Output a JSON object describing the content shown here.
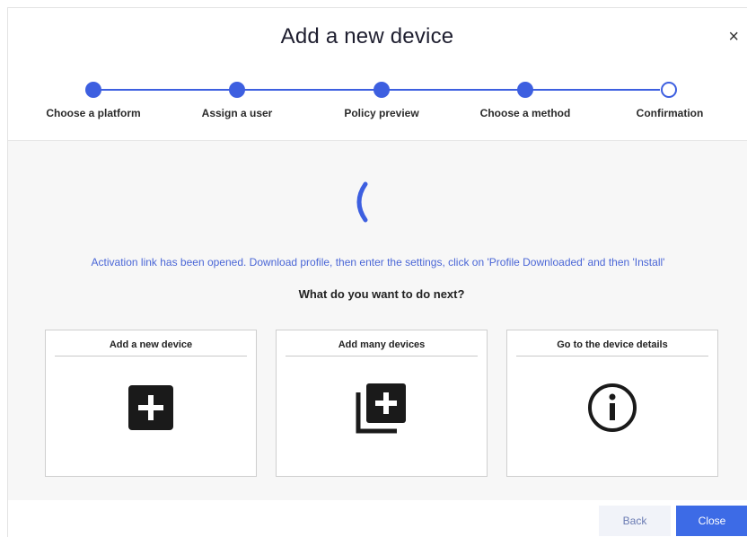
{
  "modal": {
    "title": "Add a new device",
    "close_glyph": "×"
  },
  "stepper": {
    "steps": [
      {
        "label": "Choose a platform",
        "state": "completed"
      },
      {
        "label": "Assign a user",
        "state": "completed"
      },
      {
        "label": "Policy preview",
        "state": "completed"
      },
      {
        "label": "Choose a method",
        "state": "completed"
      },
      {
        "label": "Confirmation",
        "state": "current"
      }
    ],
    "accent_color": "#3d5fe0"
  },
  "main": {
    "spinner_icon": "loading-spinner-icon",
    "activation_message": "Activation link has been opened. Download profile, then enter the settings, click on 'Profile Downloaded' and then 'Install'",
    "next_question": "What do you want to do next?",
    "cards": [
      {
        "title": "Add a new device",
        "icon": "plus-square-icon"
      },
      {
        "title": "Add many devices",
        "icon": "plus-stack-icon"
      },
      {
        "title": "Go to the device details",
        "icon": "info-circle-icon"
      }
    ]
  },
  "footer": {
    "back_label": "Back",
    "close_label": "Close",
    "primary_color": "#3d6be6"
  }
}
